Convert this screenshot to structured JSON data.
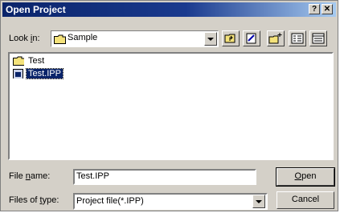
{
  "window": {
    "title": "Open Project",
    "help_label": "?",
    "close_label": "✕"
  },
  "look_in": {
    "label_pre": "Look ",
    "label_key": "i",
    "label_post": "n:",
    "value": "Sample"
  },
  "toolbar": {
    "icons": [
      "up-one-level-icon",
      "new-folder-icon",
      "favorite-icon",
      "list-view-icon",
      "details-view-icon"
    ]
  },
  "files": [
    {
      "name": "Test",
      "type": "folder",
      "selected": false
    },
    {
      "name": "Test.IPP",
      "type": "project-file",
      "selected": true
    }
  ],
  "file_name": {
    "label_pre": "File ",
    "label_key": "n",
    "label_post": "ame:",
    "value": "Test.IPP"
  },
  "files_of_type": {
    "label_pre": "Files of ",
    "label_key": "t",
    "label_post": "ype:",
    "value": "Project file(*.IPP)"
  },
  "buttons": {
    "open_key": "O",
    "open_rest": "pen",
    "cancel": "Cancel"
  },
  "colors": {
    "titlebar": "#0a246a",
    "face": "#d4d0c8",
    "selection": "#0a246a",
    "folder": "#f4e27a"
  }
}
